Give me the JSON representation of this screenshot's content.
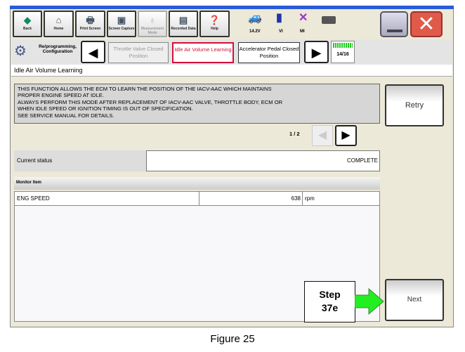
{
  "toolbar": {
    "buttons": [
      {
        "label": "Back",
        "icon": "back-arrow-icon"
      },
      {
        "label": "Home",
        "icon": "home-icon"
      },
      {
        "label": "Print Screen",
        "icon": "printer-icon"
      },
      {
        "label": "Screen Capture",
        "icon": "camera-icon"
      },
      {
        "label": "Measurement Mode",
        "icon": "probe-icon",
        "disabled": true
      },
      {
        "label": "Recorded Data",
        "icon": "data-icon"
      },
      {
        "label": "Help",
        "icon": "help-icon"
      }
    ],
    "status": {
      "voltage": "14.2V",
      "vi": "VI",
      "mi": "MI"
    }
  },
  "nav": {
    "section": "Re/programming, Configuration",
    "steps": [
      {
        "label": "Throttle Valve Closed Position",
        "state": "done"
      },
      {
        "label": "Idle Air Volume Learning",
        "state": "current"
      },
      {
        "label": "Accelerator Pedal Closed Position",
        "state": "next"
      }
    ],
    "progress": "14/16",
    "accent": "#d0103a"
  },
  "page_title": "Idle Air Volume Learning",
  "description": "THIS FUNCTION ALLOWS THE ECM TO LEARN THE POSITION OF THE IACV-AAC WHICH MAINTAINS\nPROPER ENGINE SPEED AT IDLE.\nALWAYS PERFORM THIS MODE AFTER REPLACEMENT OF IACV-AAC VALVE, THROTTLE BODY, ECM OR\nWHEN IDLE SPEED OR IGNITION TIMING IS OUT OF SPECIFICATION.\nSEE SERVICE MANUAL FOR DETAILS.",
  "pager": "1 / 2",
  "status_row": {
    "label": "Current status",
    "value": "COMPLETE"
  },
  "monitor": {
    "header": "Monitor Item",
    "rows": [
      {
        "item": "ENG SPEED",
        "value": "638",
        "unit": "rpm"
      }
    ]
  },
  "buttons": {
    "retry": "Retry",
    "next": "Next"
  },
  "callout": {
    "line1": "Step",
    "line2": "37e",
    "arrow_color": "#22ee22"
  },
  "caption": "Figure 25"
}
